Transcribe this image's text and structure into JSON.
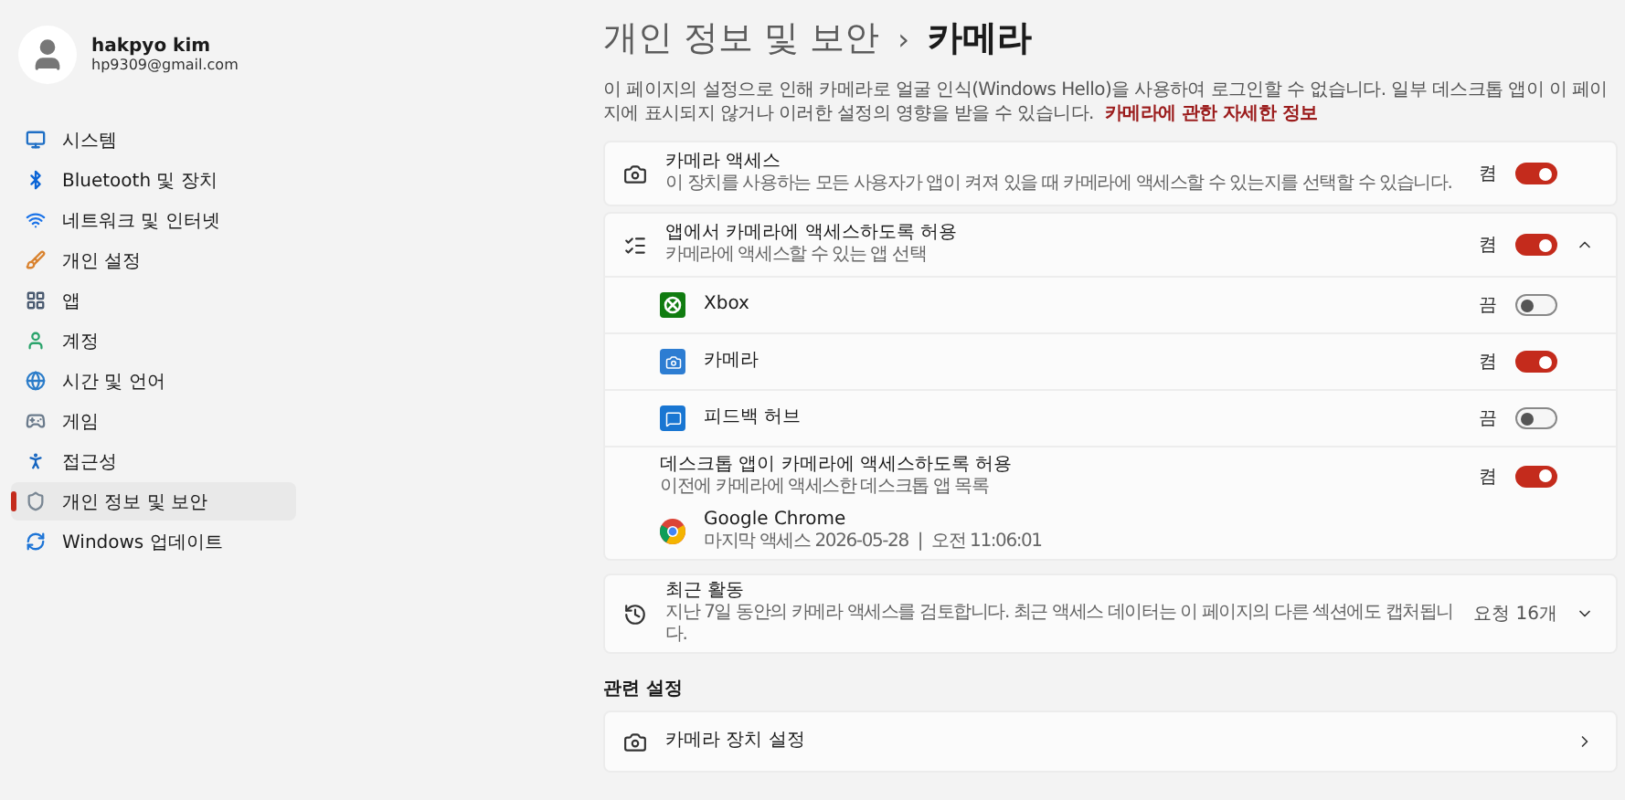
{
  "user": {
    "name": "hakpyo kim",
    "email": "hp9309@gmail.com"
  },
  "nav": [
    {
      "label": "시스템",
      "selected": false
    },
    {
      "label": "Bluetooth 및 장치",
      "selected": false
    },
    {
      "label": "네트워크 및 인터넷",
      "selected": false
    },
    {
      "label": "개인 설정",
      "selected": false
    },
    {
      "label": "앱",
      "selected": false
    },
    {
      "label": "계정",
      "selected": false
    },
    {
      "label": "시간 및 언어",
      "selected": false
    },
    {
      "label": "게임",
      "selected": false
    },
    {
      "label": "접근성",
      "selected": false
    },
    {
      "label": "개인 정보 및 보안",
      "selected": true
    },
    {
      "label": "Windows 업데이트",
      "selected": false
    }
  ],
  "breadcrumb": {
    "parent": "개인 정보 및 보안",
    "separator": "›",
    "current": "카메라"
  },
  "description": {
    "text": "이 페이지의 설정으로 인해 카메라로 얼굴 인식(Windows Hello)을 사용하여 로그인할 수 없습니다. 일부 데스크톱 앱이 이 페이지에 표시되지 않거나 이러한 설정의 영향을 받을 수 있습니다.",
    "link": "카메라에 관한 자세한 정보"
  },
  "camera_access": {
    "title": "카메라 액세스",
    "subtitle": "이 장치를 사용하는 모든 사용자가 앱이 켜져 있을 때 카메라에 액세스할 수 있는지를 선택할 수 있습니다.",
    "state_label": "켬",
    "on": true
  },
  "app_access": {
    "title": "앱에서 카메라에 액세스하도록 허용",
    "subtitle": "카메라에 액세스할 수 있는 앱 선택",
    "state_label": "켬",
    "on": true,
    "expanded": true,
    "apps": [
      {
        "name": "Xbox",
        "state_label": "끔",
        "on": false
      },
      {
        "name": "카메라",
        "state_label": "켬",
        "on": true
      },
      {
        "name": "피드백 허브",
        "state_label": "끔",
        "on": false
      }
    ],
    "desktop": {
      "title": "데스크톱 앱이 카메라에 액세스하도록 허용",
      "subtitle": "이전에 카메라에 액세스한 데스크톱 앱 목록",
      "state_label": "켬",
      "on": true,
      "apps": [
        {
          "name": "Google Chrome",
          "detail": "마지막 액세스 2026-05-28  |  오전 11:06:01"
        }
      ]
    }
  },
  "recent_activity": {
    "title": "최근 활동",
    "subtitle": "지난 7일 동안의 카메라 액세스를 검토합니다. 최근 액세스 데이터는 이 페이지의 다른 섹션에도 캡처됩니다.",
    "count": "요청 16개",
    "expanded": false
  },
  "related": {
    "heading": "관련 설정",
    "items": [
      {
        "label": "카메라 장치 설정"
      }
    ]
  }
}
